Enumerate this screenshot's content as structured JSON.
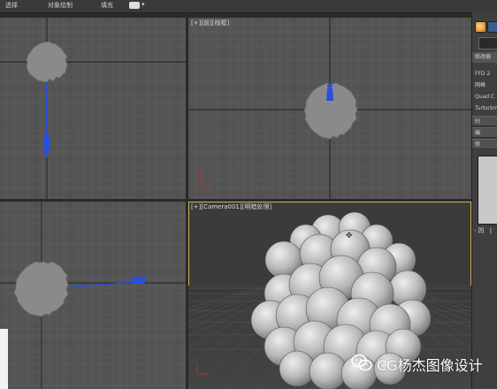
{
  "toolbar": {
    "tabs": [
      "选择",
      "对象绘制",
      "填充"
    ],
    "display_icon": "display-dropdown-icon",
    "dropdown_arrow": "▾"
  },
  "viewports": {
    "top": {
      "label": ""
    },
    "front": {
      "label": "[+][前][线框]"
    },
    "left": {
      "label": ""
    },
    "perspective": {
      "label": "[+][Camera001][明暗处理]"
    }
  },
  "command_panel": {
    "tab_icons": [
      "sphere-icon",
      "curve-icon"
    ],
    "items": [
      "修改器",
      "FFD 2",
      "网格",
      "Quad C",
      "TurboSmo",
      "扫",
      "编",
      "修"
    ],
    "bottom_icons": "-凹 |"
  },
  "watermark": {
    "text": "CG杨杰图像设计",
    "icon": "wechat-icon"
  },
  "colors": {
    "viewport_bg": "#545454",
    "perspective_bg": "#3b3b3b",
    "active_border": "#d2b64e",
    "object_gray": "#8a8a8a",
    "light_blue": "#2a4fd8",
    "grid_line": "#6a6a6a",
    "axis_line": "#222222"
  }
}
